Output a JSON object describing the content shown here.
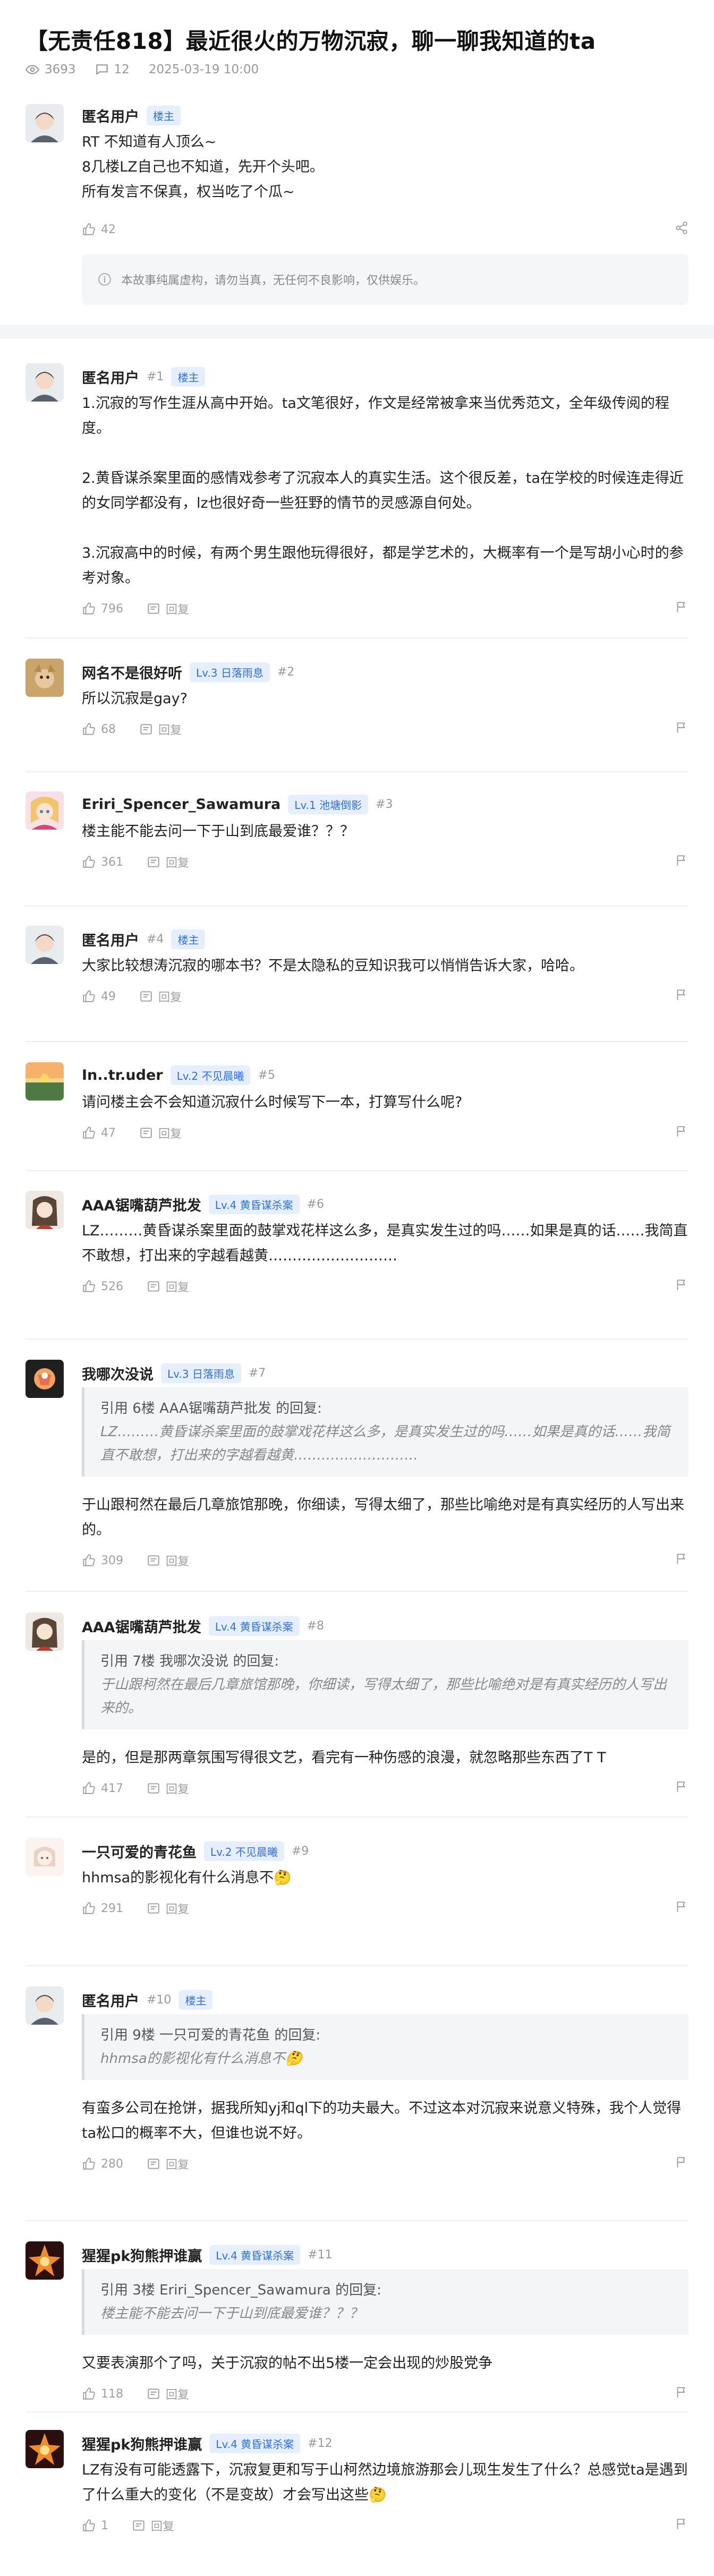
{
  "thread": {
    "title": "【无责任818】最近很火的万物沉寂，聊一聊我知道的ta",
    "views": "3693",
    "comments": "12",
    "date": "2025-03-19 10:00"
  },
  "icons": {
    "like": "thumbs-up-icon",
    "reply": "reply-icon",
    "share": "share-icon",
    "report": "flag-icon",
    "views": "eye-icon",
    "comments": "comment-icon",
    "info": "info-icon"
  },
  "colors": {
    "badge_bg": "#e6efff",
    "badge_text": "#2f6fe4",
    "quote_bg": "#f4f5f7"
  },
  "op": {
    "user": "匿名用户",
    "badge": "楼主",
    "lines": [
      "RT 不知道有人顶么~",
      "8几楼LZ自己也不知道，先开个头吧。",
      "所有发言不保真，权当吃了个瓜~"
    ],
    "likes": "42",
    "disclaimer": "本故事纯属虚构，请勿当真，无任何不良影响，仅供娱乐。"
  },
  "reply_label": "回复",
  "posts": [
    {
      "user": "匿名用户",
      "floor": "#1",
      "badge": "楼主",
      "likes": "796",
      "paras": [
        "1.沉寂的写作生涯从高中开始。ta文笔很好，作文是经常被拿来当优秀范文，全年级传阅的程度。",
        "2.黄昏谋杀案里面的感情戏参考了沉寂本人的真实生活。这个很反差，ta在学校的时候连走得近的女同学都没有，lz也很好奇一些狂野的情节的灵感源自何处。",
        "3.沉寂高中的时候，有两个男生跟他玩得很好，都是学艺术的，大概率有一个是写胡小心时的参考对象。"
      ]
    },
    {
      "user": "网名不是很好听",
      "floor": "#2",
      "badge": "Lv.3 日落雨息",
      "likes": "68",
      "paras": [
        "所以沉寂是gay?"
      ]
    },
    {
      "user": "Eriri_Spencer_Sawamura",
      "floor": "#3",
      "badge": "Lv.1 池塘倒影",
      "likes": "361",
      "paras": [
        "楼主能不能去问一下于山到底最爱谁？？？"
      ]
    },
    {
      "user": "匿名用户",
      "floor": "#4",
      "badge": "楼主",
      "likes": "49",
      "paras": [
        "大家比较想涛沉寂的哪本书？不是太隐私的豆知识我可以悄悄告诉大家，哈哈。"
      ]
    },
    {
      "user": "In..tr.uder",
      "floor": "#5",
      "badge": "Lv.2 不见晨曦",
      "likes": "47",
      "paras": [
        "请问楼主会不会知道沉寂什么时候写下一本，打算写什么呢?"
      ]
    },
    {
      "user": "AAA锯嘴葫芦批发",
      "floor": "#6",
      "badge": "Lv.4 黄昏谋杀案",
      "likes": "526",
      "paras": [
        "LZ………黄昏谋杀案里面的鼓掌戏花样这么多，是真实发生过的吗……如果是真的话……我简直不敢想，打出来的字越看越黄………………………"
      ]
    },
    {
      "user": "我哪次没说",
      "floor": "#7",
      "badge": "Lv.3 日落雨息",
      "likes": "309",
      "quote_head": "引用 6楼 AAA锯嘴葫芦批发 的回复:",
      "quote_text": "LZ………黄昏谋杀案里面的鼓掌戏花样这么多，是真实发生过的吗……如果是真的话……我简直不敢想，打出来的字越看越黄………………………",
      "paras": [
        "于山跟柯然在最后几章旅馆那晚，你细读，写得太细了，那些比喻绝对是有真实经历的人写出来的。"
      ]
    },
    {
      "user": "AAA锯嘴葫芦批发",
      "floor": "#8",
      "badge": "Lv.4 黄昏谋杀案",
      "likes": "417",
      "quote_head": "引用 7楼 我哪次没说 的回复:",
      "quote_text": "于山跟柯然在最后几章旅馆那晚，你细读，写得太细了，那些比喻绝对是有真实经历的人写出来的。",
      "paras": [
        "是的，但是那两章氛围写得很文艺，看完有一种伤感的浪漫，就忽略那些东西了T T"
      ]
    },
    {
      "user": "一只可爱的青花鱼",
      "floor": "#9",
      "badge": "Lv.2 不见晨曦",
      "likes": "291",
      "paras": [
        "hhmsa的影视化有什么消息不🤔"
      ]
    },
    {
      "user": "匿名用户",
      "floor": "#10",
      "badge": "楼主",
      "likes": "280",
      "quote_head": "引用 9楼 一只可爱的青花鱼 的回复:",
      "quote_text": "hhmsa的影视化有什么消息不🤔",
      "paras": [
        "有蛮多公司在抢饼，据我所知yj和ql下的功夫最大。不过这本对沉寂来说意义特殊，我个人觉得ta松口的概率不大，但谁也说不好。"
      ]
    },
    {
      "user": "猩猩pk狗熊押谁赢",
      "floor": "#11",
      "badge": "Lv.4 黄昏谋杀案",
      "likes": "118",
      "quote_head": "引用 3楼 Eriri_Spencer_Sawamura 的回复:",
      "quote_text": "楼主能不能去问一下于山到底最爱谁？？？",
      "paras": [
        "又要表演那个了吗，关于沉寂的帖不出5楼一定会出现的炒股党争"
      ]
    },
    {
      "user": "猩猩pk狗熊押谁赢",
      "floor": "#12",
      "badge": "Lv.4 黄昏谋杀案",
      "likes": "1",
      "paras": [
        "LZ有没有可能透露下，沉寂复更和写于山柯然边境旅游那会儿现生发生了什么？总感觉ta是遇到了什么重大的变化（不是变故）才会写出这些🤔"
      ]
    }
  ]
}
